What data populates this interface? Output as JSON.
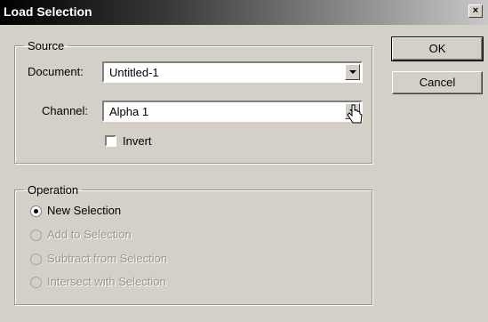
{
  "window": {
    "title": "Load Selection",
    "close_label": "×"
  },
  "source": {
    "legend": "Source",
    "document_label": "Document:",
    "document_value": "Untitled-1",
    "channel_label": "Channel:",
    "channel_value": "Alpha 1",
    "invert_label": "Invert",
    "invert_checked": false
  },
  "operation": {
    "legend": "Operation",
    "options": [
      {
        "label": "New Selection",
        "selected": true,
        "enabled": true
      },
      {
        "label": "Add to Selection",
        "selected": false,
        "enabled": false
      },
      {
        "label": "Subtract from Selection",
        "selected": false,
        "enabled": false
      },
      {
        "label": "Intersect with Selection",
        "selected": false,
        "enabled": false
      }
    ]
  },
  "buttons": {
    "ok": "OK",
    "cancel": "Cancel"
  },
  "icons": {
    "close": "close-icon",
    "dropdown": "chevron-down-icon",
    "cursor": "hand-pointer-icon"
  }
}
